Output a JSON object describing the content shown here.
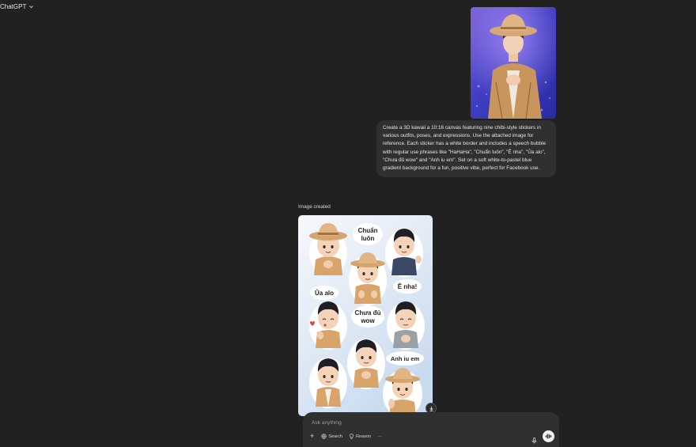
{
  "header": {
    "model_label": "ChatGPT"
  },
  "user_message": {
    "text": "Create a 3D kawaii a 10:16 canvas featuring nine chibi-style stickers in various outfits, poses, and expressions. Use the attached image for reference. Each sticker has a white border and includes a speech bubble with regular use phrases like \"HaHaHa\", \"Chuẩn luôn\", \"Ê nha\", \"Ủa alo\", \"Chưa đủ wow\" and \"Anh iu em\". Set on a soft white-to-pastel blue gradient background for a fun, positive vibe, perfect for Facebook use."
  },
  "assistant": {
    "status_label": "Image created",
    "stickers": {
      "chuan_luon_line1": "Chuẩn",
      "chuan_luon_line2": "luôn",
      "e_nha": "Ê nha!",
      "ua_alo": "Ủa alo",
      "chua_du_line1": "Chưa đủ",
      "chua_du_line2": "wow",
      "anh_iu_em": "Anh iu em"
    }
  },
  "composer": {
    "placeholder": "Ask anything",
    "search_label": "Search",
    "reason_label": "Reason",
    "more_label": "···"
  },
  "colors": {
    "background": "#212121",
    "bubble": "#303030",
    "composer": "#303030",
    "text": "#ececec"
  }
}
